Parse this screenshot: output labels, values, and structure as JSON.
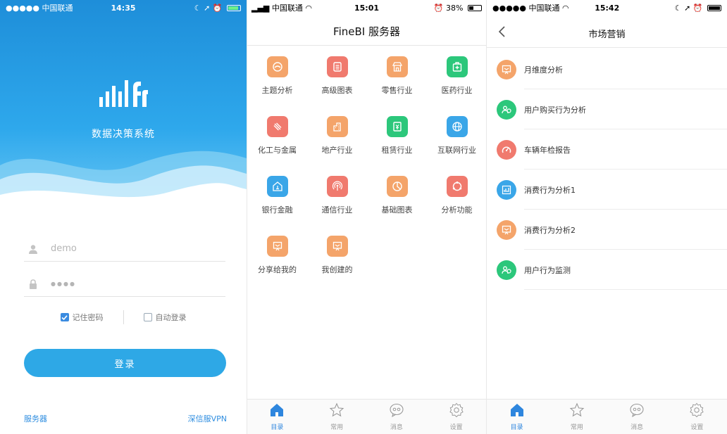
{
  "login": {
    "statusbar": {
      "carrier": "●●●●● 中国联通",
      "time": "14:35"
    },
    "app_name": "数据决策系统",
    "username": "demo",
    "password_mask": "●●●●",
    "remember_label": "记住密码",
    "remember_checked": true,
    "autologin_label": "自动登录",
    "autologin_checked": false,
    "login_button": "登录",
    "server_link": "服务器",
    "vpn_link": "深信服VPN",
    "colors": {
      "primary": "#2ea8e6",
      "link": "#2f8ee0"
    }
  },
  "home": {
    "statusbar": {
      "carrier": "中国联通",
      "time": "15:01",
      "battery": "38%",
      "battery_level": 0.38
    },
    "title": "FineBI 服务器",
    "tiles": [
      {
        "label": "主题分析",
        "icon": "theme-analysis-icon",
        "color": "#f4a46a"
      },
      {
        "label": "高级图表",
        "icon": "advanced-chart-icon",
        "color": "#f07a6e"
      },
      {
        "label": "零售行业",
        "icon": "retail-icon",
        "color": "#f4a46a"
      },
      {
        "label": "医药行业",
        "icon": "medicine-icon",
        "color": "#2cc77b"
      },
      {
        "label": "化工与金属",
        "icon": "chemical-icon",
        "color": "#f07a6e"
      },
      {
        "label": "地产行业",
        "icon": "real-estate-icon",
        "color": "#f4a46a"
      },
      {
        "label": "租赁行业",
        "icon": "leasing-icon",
        "color": "#2cc77b"
      },
      {
        "label": "互联网行业",
        "icon": "globe-icon",
        "color": "#3aa6e8"
      },
      {
        "label": "银行金融",
        "icon": "bank-icon",
        "color": "#3aa6e8"
      },
      {
        "label": "通信行业",
        "icon": "signal-icon",
        "color": "#f07a6e"
      },
      {
        "label": "基础图表",
        "icon": "basic-chart-icon",
        "color": "#f4a46a"
      },
      {
        "label": "分析功能",
        "icon": "analysis-function-icon",
        "color": "#f07a6e"
      },
      {
        "label": "分享给我的",
        "icon": "shared-with-me-icon",
        "color": "#f4a46a"
      },
      {
        "label": "我创建的",
        "icon": "created-by-me-icon",
        "color": "#f4a46a"
      }
    ],
    "tabs": [
      {
        "label": "目录",
        "icon": "home-icon",
        "active": true
      },
      {
        "label": "常用",
        "icon": "star-icon",
        "active": false
      },
      {
        "label": "消息",
        "icon": "message-icon",
        "active": false
      },
      {
        "label": "设置",
        "icon": "settings-icon",
        "active": false
      }
    ]
  },
  "list": {
    "statusbar": {
      "carrier": "●●●●● 中国联通",
      "time": "15:42"
    },
    "title": "市场营销",
    "items": [
      {
        "label": "月维度分析",
        "icon": "presentation-icon",
        "color": "#f4a46a"
      },
      {
        "label": "用户购买行为分析",
        "icon": "users-icon",
        "color": "#2cc77b"
      },
      {
        "label": "车辆年检报告",
        "icon": "gauge-icon",
        "color": "#f07a6e"
      },
      {
        "label": "消费行为分析1",
        "icon": "bar-chart-icon",
        "color": "#3aa6e8"
      },
      {
        "label": "消费行为分析2",
        "icon": "presentation-icon",
        "color": "#f4a46a"
      },
      {
        "label": "用户行为监测",
        "icon": "users-icon",
        "color": "#2cc77b"
      }
    ],
    "tabs": [
      {
        "label": "目录",
        "icon": "home-icon",
        "active": true
      },
      {
        "label": "常用",
        "icon": "star-icon",
        "active": false
      },
      {
        "label": "消息",
        "icon": "message-icon",
        "active": false
      },
      {
        "label": "设置",
        "icon": "settings-icon",
        "active": false
      }
    ]
  }
}
